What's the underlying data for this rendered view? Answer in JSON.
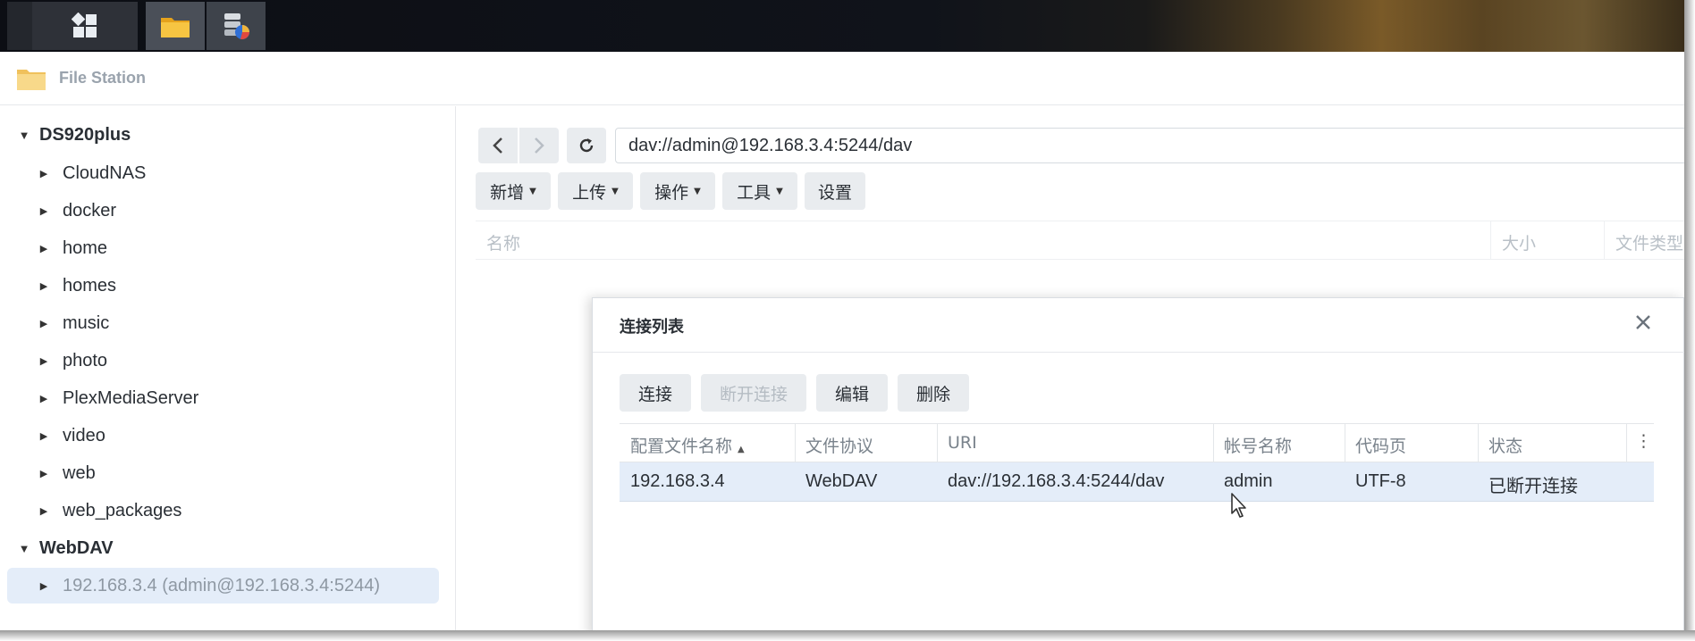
{
  "app": {
    "title": "File Station"
  },
  "tree": {
    "roots": [
      {
        "label": "DS920plus",
        "children": [
          "CloudNAS",
          "docker",
          "home",
          "homes",
          "music",
          "photo",
          "PlexMediaServer",
          "video",
          "web",
          "web_packages"
        ]
      },
      {
        "label": "WebDAV",
        "children": [
          "192.168.3.4 (admin@192.168.3.4:5244)"
        ]
      }
    ]
  },
  "main": {
    "path": "dav://admin@192.168.3.4:5244/dav",
    "toolbar": {
      "new": "新增",
      "upload": "上传",
      "action": "操作",
      "tools": "工具",
      "settings": "设置"
    },
    "columns": {
      "name": "名称",
      "size": "大小",
      "type": "文件类型"
    }
  },
  "dialog": {
    "title": "连接列表",
    "buttons": {
      "connect": "连接",
      "disconnect": "断开连接",
      "edit": "编辑",
      "delete": "删除"
    },
    "columns": {
      "profile": "配置文件名称",
      "protocol": "文件协议",
      "uri": "URI",
      "account": "帐号名称",
      "codepage": "代码页",
      "status": "状态"
    },
    "rows": [
      {
        "profile": "192.168.3.4",
        "protocol": "WebDAV",
        "uri": "dav://192.168.3.4:5244/dav",
        "account": "admin",
        "codepage": "UTF-8",
        "status": "已断开连接"
      }
    ]
  },
  "icons": {
    "close": "close-icon",
    "refresh": "refresh-icon",
    "back": "chevron-left-icon",
    "forward": "chevron-right-icon",
    "more": "kebab-menu-icon",
    "sort": "sort-ascending-icon"
  }
}
